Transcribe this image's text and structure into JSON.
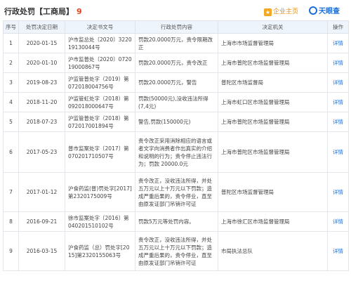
{
  "header": {
    "title": "行政处罚【工商局】",
    "count": "9",
    "favorite_label": "企业主页",
    "logo_text": "天眼查"
  },
  "table": {
    "columns": [
      "序号",
      "处罚决定日期",
      "决定书文号",
      "行政处罚内容",
      "决定机关",
      "操作"
    ],
    "rows": [
      {
        "no": "1",
        "date": "2020-01-15",
        "doc": "沪市监总处〔2020〕322019130044号",
        "content": "罚款20.0000万元，责令限期改正",
        "org": "上海市市场监督管理局",
        "action": "详情"
      },
      {
        "no": "2",
        "date": "2020-01-10",
        "doc": "沪市监普处〔2020〕072019000867号",
        "content": "罚款20.0000万元，责令改正",
        "org": "上海市普陀区市场监督管理局",
        "action": "详情"
      },
      {
        "no": "3",
        "date": "2019-08-23",
        "doc": "沪监管普处字（2019）第072018004756号",
        "content": "罚款20.0000万元，警告",
        "org": "普陀区市场监督局",
        "action": "详情"
      },
      {
        "no": "4",
        "date": "2018-11-20",
        "doc": "沪监管虹处字（2018）第092018000647号",
        "content": "罚款(50000元),没收违法所得(7,4元)",
        "org": "上海市虹口区市场监督管理局",
        "action": "详情"
      },
      {
        "no": "5",
        "date": "2018-07-23",
        "doc": "沪监管普处字（2018）第072017001894号",
        "content": "警告,罚款(150000元)",
        "org": "上海市普陀区市场监督管理局",
        "action": "详情"
      },
      {
        "no": "6",
        "date": "2017-05-23",
        "doc": "普市监案处字〔2017〕第070201710507号",
        "content": "责令改正采用消除相应的语言或者文字向消费者作出真实的介绍和说明的行为；责令停止违法行为；罚款 20000.0元",
        "org": "上海市普陀区市场监督管理局",
        "action": "详情"
      },
      {
        "no": "7",
        "date": "2017-01-12",
        "doc": "沪食药监(普)罚处字[2017]第2320175009号",
        "content": "责令改正，没收违法所得，并处五万元以上十万元以下罚款；造成严重后果的，责令停业，直至由原发证部门吊销许可证",
        "org": "普陀区市场监督管理局",
        "action": "详情"
      },
      {
        "no": "8",
        "date": "2016-09-21",
        "doc": "徐市监案处字〔2016〕第040201510102号",
        "content": "罚款5万元等处罚内容。",
        "org": "上海市徐汇区市场监督管理局",
        "action": "详情"
      },
      {
        "no": "9",
        "date": "2016-03-15",
        "doc": "沪食药监（总）罚处字[2015]第2320155063号",
        "content": "责令改正，没收违法所得，并处五万元以上十万元以下罚款；造成严重后果的，责令停业，直至由原发证部门吊销许可证",
        "org": "市局执法总队",
        "action": "详情"
      }
    ]
  }
}
